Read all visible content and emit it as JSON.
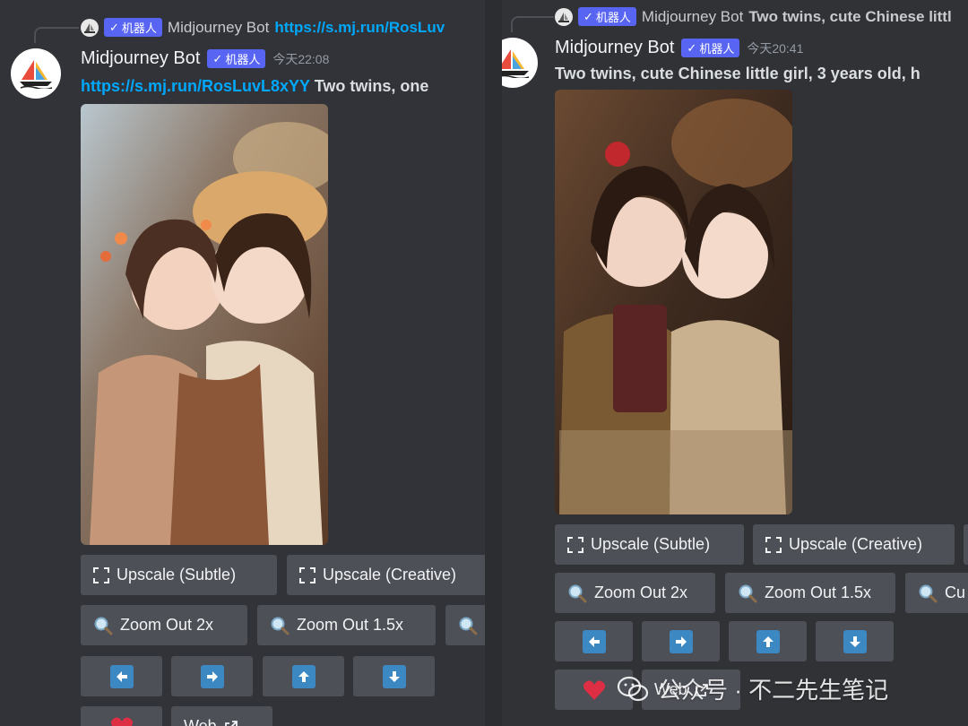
{
  "bot_tag": "机器人",
  "left": {
    "reply": {
      "name": "Midjourney Bot",
      "link": "https://s.mj.run/RosLuv"
    },
    "author": "Midjourney Bot",
    "timestamp": "今天22:08",
    "message_link": "https://s.mj.run/RosLuvL8xYY",
    "message_text": "Two twins, one",
    "buttons": {
      "upscale_subtle": "Upscale (Subtle)",
      "upscale_creative": "Upscale (Creative)",
      "zoom_out_2x": "Zoom Out 2x",
      "zoom_out_15x": "Zoom Out 1.5x",
      "web": "Web"
    }
  },
  "right": {
    "reply": {
      "name": "Midjourney Bot",
      "text": "Two twins, cute Chinese littl"
    },
    "author": "Midjourney Bot",
    "timestamp": "今天20:41",
    "message_text": "Two twins, cute Chinese little girl, 3 years old, h",
    "buttons": {
      "upscale_subtle": "Upscale (Subtle)",
      "upscale_creative": "Upscale (Creative)",
      "zoom_out_2x": "Zoom Out 2x",
      "zoom_out_15x": "Zoom Out 1.5x",
      "custom_zoom_partial": "Cu",
      "web": "Web"
    }
  },
  "watermark": {
    "text": "公众号 · 不二先生笔记"
  },
  "colors": {
    "background": "#313338",
    "button": "#4e5058",
    "link": "#00a8fc",
    "bot_tag": "#5865f2",
    "arrow": "#3b88c3"
  }
}
